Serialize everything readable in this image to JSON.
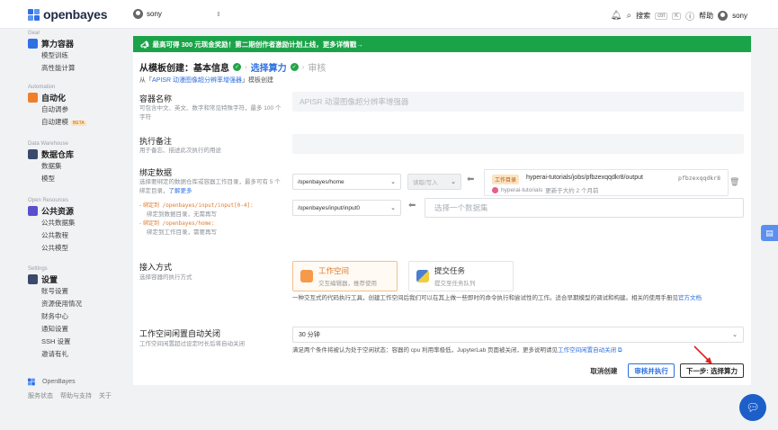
{
  "topbar": {
    "logo_text": "openbayes",
    "user": "sony",
    "search_label": "搜索",
    "search_kbd": [
      "ctrl",
      "K"
    ],
    "help_label": "帮助",
    "account_name": "sony"
  },
  "sidebar": {
    "groups": [
      {
        "caption": "Gear",
        "title": "算力容器",
        "color": "#2f6fe4",
        "items": [
          "模型训练",
          "高性能计算"
        ]
      },
      {
        "caption": "Automation",
        "title": "自动化",
        "color": "#f07f2a",
        "items": [
          "自动调参",
          "自动建模"
        ],
        "beta": "BETA"
      },
      {
        "caption": "Data Warehouse",
        "title": "数据仓库",
        "color": "#3a4a6b",
        "items": [
          "数据集",
          "模型"
        ]
      },
      {
        "caption": "Open Resources",
        "title": "公共资源",
        "color": "#5a4fcf",
        "items": [
          "公共数据集",
          "公共教程",
          "公共模型"
        ]
      },
      {
        "caption": "Settings",
        "title": "设置",
        "color": "#3a4a6b",
        "items": [
          "账号设置",
          "资源使用情况",
          "财务中心",
          "通知设置",
          "SSH 设置",
          "邀请有礼"
        ]
      }
    ],
    "footer_brand": "OpenBayes",
    "footer_links": [
      "服务状态",
      "帮助与支持",
      "关于"
    ]
  },
  "banner": {
    "text": "最高可得 300 元现金奖励！第二期创作者激励计划上线，更多详情戳→"
  },
  "steps": {
    "step1": "从模板创建：基本信息",
    "step2": "选择算力",
    "step3": "审核"
  },
  "from": {
    "prefix": "从「",
    "template": "APISR 动漫图像超分辨率增强器",
    "suffix": "」模板创建"
  },
  "container_name": {
    "label": "容器名称",
    "hint": "可包含中文、英文、数字和常见特殊字符，最多 100 个字符",
    "value": "APISR 动漫图像超分辨率增强器"
  },
  "notes": {
    "label": "执行备注",
    "hint": "用于备忘、描述此次执行的用途",
    "value": ""
  },
  "bind": {
    "label": "绑定数据",
    "hint": "选择要绑定的数据仓库或容器工作目录，最多可有 5 个绑定目录，",
    "hint_link": "了解更多",
    "row1_path": "/openbayes/home",
    "row1_mode": "读取/写入",
    "row2_path": "/openbayes/input/input0",
    "dataset_placeholder": "选择一个数据集",
    "ws_tag": "工作目录",
    "ws_path": "hyperai-tutorials/jobs/pfbzexqqdkr8/output",
    "ws_id": "pfbzexqqdkr8",
    "ws_owner": "hyperai-tutorials",
    "ws_updated": "更新于大约 2 个月前",
    "rule1_code": "绑定到 /openbayes/input/input[0-4]:",
    "rule1_desc": "绑定到数据目录，无需再写",
    "rule2_code": "绑定到 /openbayes/home:",
    "rule2_desc": "绑定到工作目录，需要再写"
  },
  "access": {
    "label": "接入方式",
    "hint": "选择容器的执行方式",
    "mode1_title": "工作空间",
    "mode1_sub": "交互编辑器，推荐使用",
    "mode2_title": "提交任务",
    "mode2_sub": "提交至任务队列",
    "desc": "一种交互式的代码执行工具，创建工作空间后我们可以在其上做一些即时的命令执行和尝试性的工作。适合早期模型的调试和构建。相关的使用手册见",
    "desc_link": "官方文档"
  },
  "idle": {
    "label": "工作空间闲置自动关闭",
    "hint": "工作空间闲置超过设定时长后将自动关闭",
    "value": "30 分钟",
    "desc": "满足两个条件将被认为处于空闲状态：容器的 cpu 利用率极低，JupyterLab 页面被关闭，更多说明请见",
    "desc_link": "工作空间闲置自动关闭"
  },
  "actions": {
    "cancel": "取消创建",
    "review": "审核并执行",
    "next": "下一步: 选择算力"
  }
}
